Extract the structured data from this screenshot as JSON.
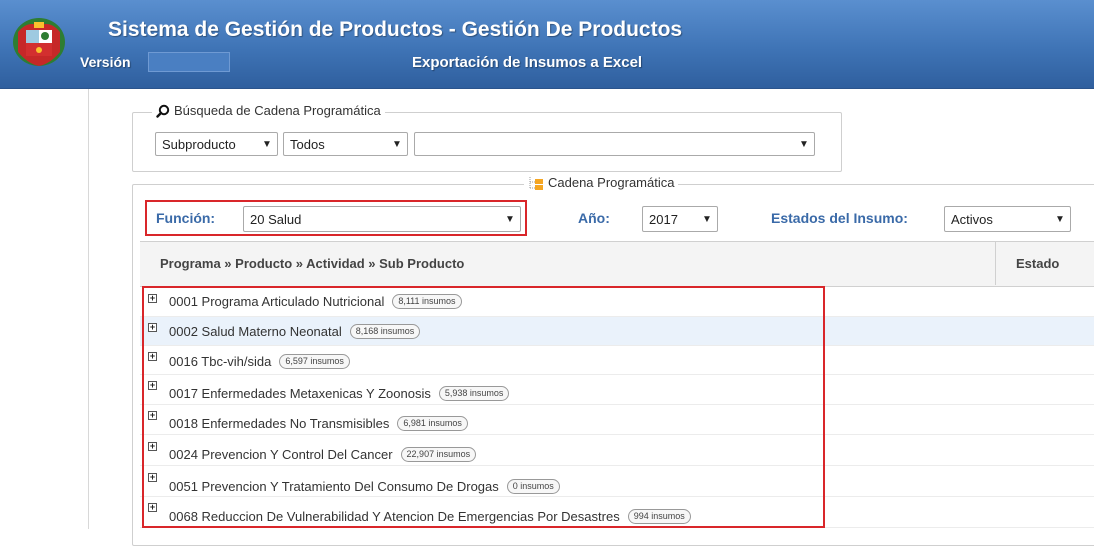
{
  "header": {
    "title": "Sistema de Gestión de Productos - Gestión De Productos",
    "version_label": "Versión",
    "version_value": "",
    "subtitle": "Exportación de Insumos a Excel"
  },
  "search": {
    "legend": "Búsqueda de Cadena Programática",
    "level_select": "Subproducto",
    "filter_select": "Todos",
    "value_select": ""
  },
  "cadena": {
    "legend": "Cadena Programática",
    "funcion_label": "Función:",
    "funcion_value": "20 Salud",
    "anio_label": "Año:",
    "anio_value": "2017",
    "estados_label": "Estados del Insumo:",
    "estados_value": "Activos"
  },
  "grid": {
    "col_main": "Programa » Producto » Actividad » Sub Producto",
    "col_estado": "Estado",
    "rows": [
      {
        "label": "0001 Programa Articulado Nutricional",
        "badge": "8,111 insumos"
      },
      {
        "label": "0002 Salud Materno Neonatal",
        "badge": "8,168 insumos"
      },
      {
        "label": "0016 Tbc-vih/sida",
        "badge": "6,597 insumos"
      },
      {
        "label": "0017 Enfermedades Metaxenicas Y Zoonosis",
        "badge": "5,938 insumos"
      },
      {
        "label": "0018 Enfermedades No Transmisibles",
        "badge": "6,981 insumos"
      },
      {
        "label": "0024 Prevencion Y Control Del Cancer",
        "badge": "22,907 insumos"
      },
      {
        "label": "0051 Prevencion Y Tratamiento Del Consumo De Drogas",
        "badge": "0 insumos"
      },
      {
        "label": "0068 Reduccion De Vulnerabilidad Y Atencion De Emergencias Por Desastres",
        "badge": "994 insumos"
      }
    ]
  },
  "colors": {
    "header_blue": "#3f74b6",
    "highlight_red": "#d9262a",
    "label_blue": "#3a6aa8",
    "row_alt": "#eaf2fb"
  },
  "icons": {
    "logo": "peru-coat-of-arms",
    "search": "search-icon",
    "tree": "tree-icon",
    "expand": "plus-box-icon",
    "dropdown": "chevron-down-icon"
  }
}
